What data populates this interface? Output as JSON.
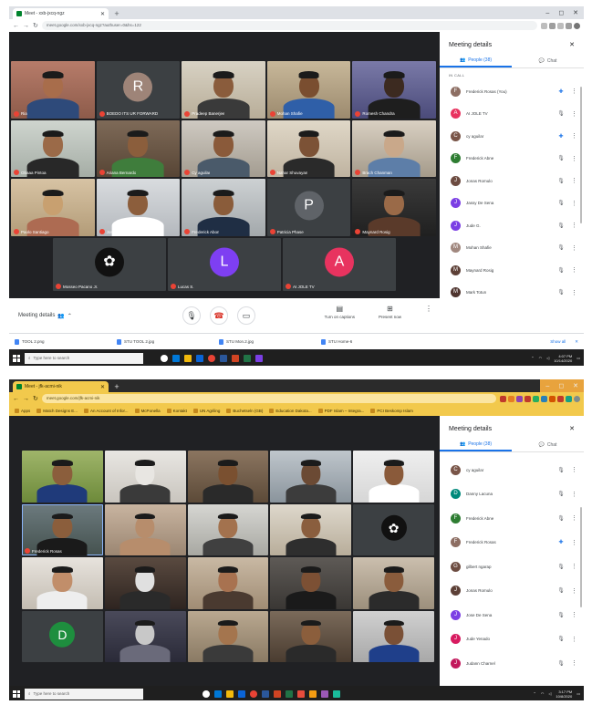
{
  "shot1": {
    "tab": {
      "title": "Meet - xxb-jxcq-ngz"
    },
    "window_controls": [
      "–",
      "◻",
      "✕"
    ],
    "address": {
      "url": "meet.google.com/xxb-jxcq-ngz?authuser=0&hs=122"
    },
    "tiles": [
      {
        "name": "Ria",
        "type": "video",
        "bg1": "#b77c6a",
        "bg2": "#8d5b4a",
        "skin": "#a86d4b",
        "shirt": "#2e4a7a"
      },
      {
        "name": "BOEDO ITS UR FORWARD",
        "type": "avatar",
        "letter": "R",
        "color": "#9e8478"
      },
      {
        "name": "Pradeep Banerjee",
        "type": "video",
        "bg1": "#d8d2c4",
        "bg2": "#b8ad98",
        "skin": "#8a5c3c",
        "shirt": "#3a3a3a"
      },
      {
        "name": "Mohan Shafie",
        "type": "video",
        "bg1": "#c8b89a",
        "bg2": "#9c8a6e",
        "skin": "#7a4e30",
        "shirt": "#2f5fa8"
      },
      {
        "name": "Romesh Chandra",
        "type": "video",
        "bg1": "#7a7aa8",
        "bg2": "#4b4b7a",
        "skin": "#3c2a20",
        "shirt": "#1e1e1e"
      },
      {
        "name": "Obaaa Pintoa",
        "type": "video",
        "bg1": "#cfd5cf",
        "bg2": "#a5ada5",
        "skin": "#9b6a48",
        "shirt": "#282828"
      },
      {
        "name": "Ariana Bernardo",
        "type": "video",
        "bg1": "#7e6a58",
        "bg2": "#574535",
        "skin": "#8b5e3c",
        "shirt": "#3f7d3c"
      },
      {
        "name": "Cy aguilar",
        "type": "video",
        "bg1": "#cfcac2",
        "bg2": "#a39c90",
        "skin": "#8a5a3a",
        "shirt": "#4a5a6a"
      },
      {
        "name": "Nahar Shuvayan",
        "type": "video",
        "bg1": "#e0d8c8",
        "bg2": "#bfb3a0",
        "skin": "#7c5236",
        "shirt": "#2a2a2a"
      },
      {
        "name": "Brach Chanman",
        "type": "video",
        "bg1": "#d9d0c2",
        "bg2": "#a49a8a",
        "skin": "#c9a88a",
        "shirt": "#5d7ea8"
      },
      {
        "name": "Paolo Santiago",
        "type": "video",
        "bg1": "#d7c3a4",
        "bg2": "#b39c78",
        "skin": "#c8a070",
        "shirt": "#ad6b52"
      },
      {
        "name": "Jose De Sena",
        "type": "video",
        "bg1": "#d9dcdf",
        "bg2": "#b4b8bd",
        "skin": "#8c5e3c",
        "shirt": "#ffffff"
      },
      {
        "name": "Frederick Abon",
        "type": "video",
        "bg1": "#cdd1d3",
        "bg2": "#a3a8ab",
        "skin": "#8a5c3a",
        "shirt": "#1f2e44"
      },
      {
        "name": "Patricia Phase",
        "type": "avatar",
        "letter": "P",
        "color": "#5f6368"
      },
      {
        "name": "Maynard Rosig",
        "type": "video",
        "bg1": "#3a3a3a",
        "bg2": "#202020",
        "skin": "#9a6a48",
        "shirt": "#5a3a2a"
      }
    ],
    "bottom_tiles": [
      {
        "name": "Mosseo Pacano Jr.",
        "type": "avatar",
        "letter": "✿",
        "color": "#111111"
      },
      {
        "name": "Lucas S.",
        "type": "avatar",
        "letter": "L",
        "color": "#7e3ff2"
      },
      {
        "name": "AI JOLE TV",
        "type": "avatar",
        "letter": "A",
        "color": "#e8335f"
      }
    ],
    "controls": {
      "meeting_details": "Meeting details",
      "captions": "Turn on captions",
      "present": "Present now"
    },
    "panel": {
      "title": "Meeting details",
      "people_tab": "People (38)",
      "chat_tab": "Chat",
      "section": "IN CALL",
      "people": [
        {
          "name": "Frederick Rosas (You)",
          "letter": "F",
          "color": "#8d6e63",
          "mic": "on"
        },
        {
          "name": "AI JOLE TV",
          "letter": "A",
          "color": "#e8335f",
          "mic": "off"
        },
        {
          "name": "cy aguilar",
          "letter": "C",
          "color": "#795548",
          "mic": "on"
        },
        {
          "name": "Frederick Abne",
          "letter": "F",
          "color": "#2e7d32",
          "mic": "off"
        },
        {
          "name": "Jonas Romulo",
          "letter": "J",
          "color": "#6d4c41",
          "mic": "off"
        },
        {
          "name": "Jassy De Sena",
          "letter": "J",
          "color": "#7b3fe4",
          "mic": "off"
        },
        {
          "name": "Jude G.",
          "letter": "J",
          "color": "#7b3fe4",
          "mic": "off"
        },
        {
          "name": "Mohan Shafie",
          "letter": "M",
          "color": "#a1887f",
          "mic": "off"
        },
        {
          "name": "Maynard Rosig",
          "letter": "M",
          "color": "#5d4037",
          "mic": "off"
        },
        {
          "name": "Mark Totun",
          "letter": "M",
          "color": "#4e342e",
          "mic": "off"
        }
      ]
    },
    "downloads": {
      "files": [
        "TOOL 2.png",
        "STU TOOL 2.jpg",
        "STU Mon.2.jpg",
        "STU Home-6"
      ],
      "show_all": "Show all",
      "close": "✕"
    },
    "taskbar": {
      "search": "Type here to search",
      "time": "4:07 PM",
      "date": "10/14/2020"
    }
  },
  "shot2": {
    "tab": {
      "title": "Meet - jfk-acmi-nik"
    },
    "window_controls": [
      "–",
      "◻",
      "✕"
    ],
    "address": {
      "url": "meet.google.com/jfk-acmi-nik"
    },
    "bookmarks": [
      "Apps",
      "Match Designs E...",
      "An Account of Infor...",
      "McPonella",
      "Kontakt",
      "UN Agriling",
      "Buchetseln (GB)",
      "Education Dakota...",
      "PDF Islam – Integra...",
      "PCI Beskomp Islam"
    ],
    "tiles": [
      {
        "name": "",
        "type": "video",
        "bg1": "#9fb56a",
        "bg2": "#6d8a3a",
        "skin": "#8b5e3c",
        "shirt": "#1f3a7a"
      },
      {
        "name": "",
        "type": "video",
        "bg1": "#e8e6e2",
        "bg2": "#c9c5be",
        "skin": "#e8e6e2",
        "shirt": "#3a3a3a"
      },
      {
        "name": "",
        "type": "video",
        "bg1": "#8b7560",
        "bg2": "#5c4a38",
        "skin": "#7a5030",
        "shirt": "#2a2a2a"
      },
      {
        "name": "",
        "type": "video",
        "bg1": "#bfc6cc",
        "bg2": "#8a949c",
        "skin": "#6b4a34",
        "shirt": "#3c3c3c"
      },
      {
        "name": "",
        "type": "video",
        "bg1": "#efefef",
        "bg2": "#d6d6d6",
        "skin": "#8a5a3a",
        "shirt": "#ffffff"
      },
      {
        "name": "Frederick Rosas",
        "type": "video",
        "bg1": "#6c7a7e",
        "bg2": "#45524f",
        "skin": "#8b5e3c",
        "shirt": "#1a1a1a"
      },
      {
        "name": "",
        "type": "video",
        "bg1": "#c8b4a0",
        "bg2": "#9b8672",
        "skin": "#b78d6c",
        "shirt": "#b78d6c"
      },
      {
        "name": "",
        "type": "video",
        "bg1": "#d6d6d2",
        "bg2": "#a8a8a2",
        "skin": "#a3724e",
        "shirt": "#404040"
      },
      {
        "name": "",
        "type": "video",
        "bg1": "#ded8cc",
        "bg2": "#b8ad9a",
        "skin": "#8a5e3e",
        "shirt": "#2e2e2e"
      },
      {
        "name": "",
        "type": "avatar",
        "letter": "✿",
        "color": "#111111"
      },
      {
        "name": "",
        "type": "video",
        "bg1": "#e7e3dd",
        "bg2": "#c4bdb2",
        "skin": "#c18e6a",
        "shirt": "#eeeeee"
      },
      {
        "name": "",
        "type": "video",
        "bg1": "#5a4a40",
        "bg2": "#2e2420",
        "skin": "#e0e0e0",
        "shirt": "#2a2a2a"
      },
      {
        "name": "",
        "type": "video",
        "bg1": "#c9b9a4",
        "bg2": "#a08c74",
        "skin": "#a87250",
        "shirt": "#4a3a30"
      },
      {
        "name": "",
        "type": "video",
        "bg1": "#5e5a56",
        "bg2": "#3a3734",
        "skin": "#7c5034",
        "shirt": "#1a1a1a"
      },
      {
        "name": "",
        "type": "video",
        "bg1": "#cbbfae",
        "bg2": "#9c8f7c",
        "skin": "#8a5c3c",
        "shirt": "#2b2b2b"
      },
      {
        "name": "",
        "type": "avatar",
        "letter": "D",
        "color": "#1e8e3e"
      },
      {
        "name": "",
        "type": "video",
        "bg1": "#4a4a5a",
        "bg2": "#2a2a38",
        "skin": "#c8c8c8",
        "shirt": "#6a6a7a"
      },
      {
        "name": "",
        "type": "video",
        "bg1": "#b9a890",
        "bg2": "#8a7a64",
        "skin": "#a4754e",
        "shirt": "#3a3a3a"
      },
      {
        "name": "",
        "type": "video",
        "bg1": "#7a6a5a",
        "bg2": "#4a3c30",
        "skin": "#8b5e3c",
        "shirt": "#2a2a2a"
      },
      {
        "name": "",
        "type": "video",
        "bg1": "#d0d0d0",
        "bg2": "#a8a8a8",
        "skin": "#7a5036",
        "shirt": "#1f3f8a"
      }
    ],
    "panel": {
      "title": "Meeting details",
      "people_tab": "People (38)",
      "chat_tab": "Chat",
      "people": [
        {
          "name": "cy aguilar",
          "letter": "C",
          "color": "#795548",
          "mic": "off"
        },
        {
          "name": "Danny Lacuna",
          "letter": "D",
          "color": "#00897b",
          "mic": "off"
        },
        {
          "name": "Frederick Abne",
          "letter": "F",
          "color": "#2e7d32",
          "mic": "off"
        },
        {
          "name": "Frederick Rosas",
          "letter": "F",
          "color": "#8d6e63",
          "mic": "on"
        },
        {
          "name": "gilbert ngarap",
          "letter": "G",
          "color": "#6d4c41",
          "mic": "off"
        },
        {
          "name": "Jonas Romulo",
          "letter": "J",
          "color": "#5d4037",
          "mic": "off"
        },
        {
          "name": "Jose De Sena",
          "letter": "J",
          "color": "#7b3fe4",
          "mic": "off"
        },
        {
          "name": "Jude Yenado",
          "letter": "J",
          "color": "#d81b60",
          "mic": "off"
        },
        {
          "name": "Judann Charnel",
          "letter": "J",
          "color": "#c2185b",
          "mic": "off"
        }
      ]
    },
    "taskbar": {
      "search": "Type here to search",
      "time": "3:17 PM",
      "date": "10/8/2020"
    }
  }
}
